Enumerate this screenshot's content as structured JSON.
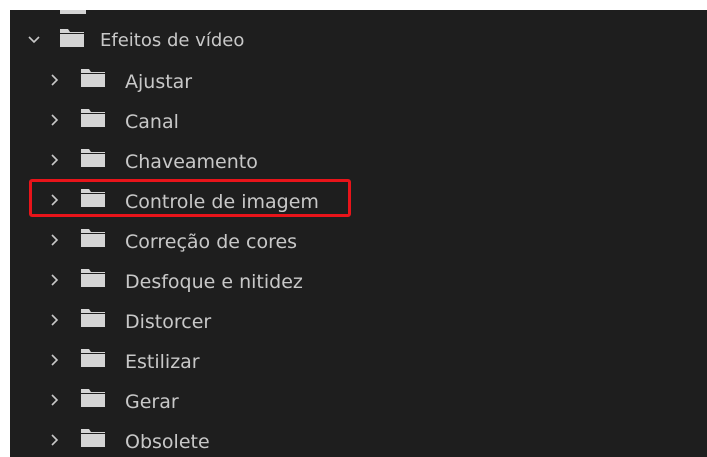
{
  "panel": {
    "parent": {
      "label": "Efeitos de vídeo",
      "expanded": true
    },
    "children": [
      {
        "label": "Ajustar"
      },
      {
        "label": "Canal"
      },
      {
        "label": "Chaveamento"
      },
      {
        "label": "Controle de imagem",
        "highlighted": true
      },
      {
        "label": "Correção de cores"
      },
      {
        "label": "Desfoque e nitidez"
      },
      {
        "label": "Distorcer"
      },
      {
        "label": "Estilizar"
      },
      {
        "label": "Gerar"
      },
      {
        "label": "Obsolete"
      }
    ]
  },
  "colors": {
    "panel_bg": "#1e1e1e",
    "text": "#c8c8c8",
    "folder": "#d4d4d4",
    "highlight": "#e8141a"
  },
  "icons": {
    "expand": "chevron-down-icon",
    "collapse": "chevron-right-icon",
    "folder": "folder-icon"
  }
}
